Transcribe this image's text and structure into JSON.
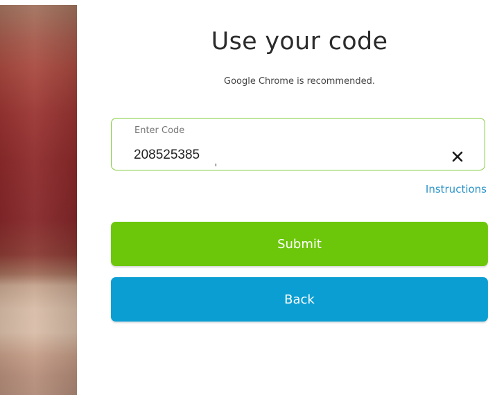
{
  "page": {
    "title": "Use your code",
    "subtitle": "Google Chrome is recommended."
  },
  "code_field": {
    "label": "Enter Code",
    "value": "208525385"
  },
  "instructions_link": "Instructions",
  "buttons": {
    "submit_label": "Submit",
    "back_label": "Back"
  },
  "colors": {
    "accent_green": "#6cc70a",
    "accent_blue": "#0a9ed2",
    "link_blue": "#2d94c8",
    "field_border": "#7fcc3a"
  },
  "icons": {
    "clear": "close-icon"
  }
}
